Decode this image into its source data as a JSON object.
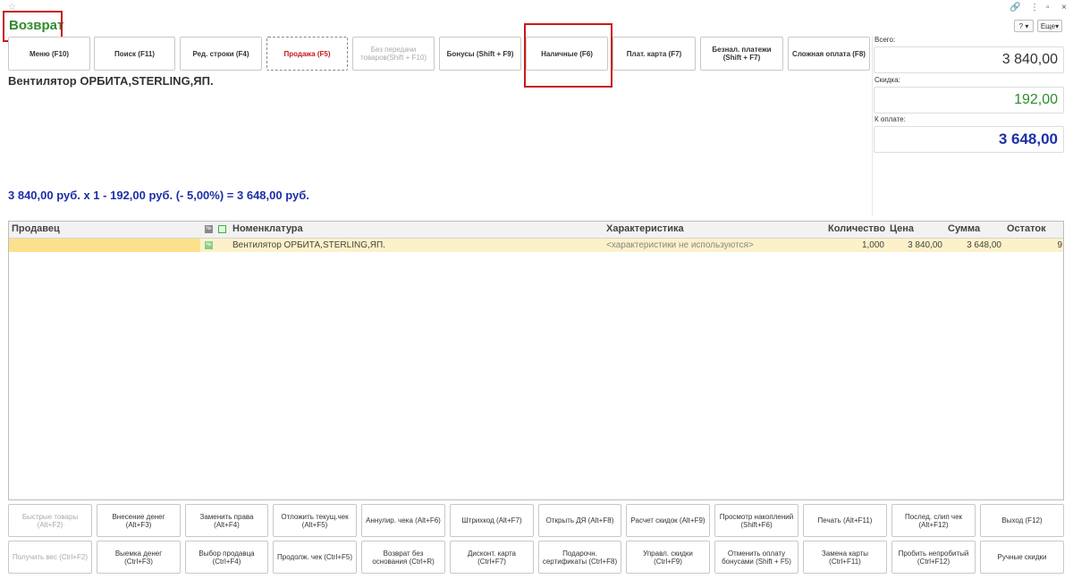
{
  "window": {
    "title": "Возврат",
    "more_label": "Еще"
  },
  "toolbar": [
    {
      "id": "menu",
      "label": "Меню (F10)"
    },
    {
      "id": "search",
      "label": "Поиск (F11)"
    },
    {
      "id": "edit-row",
      "label": "Ред. строки (F4)"
    },
    {
      "id": "sale",
      "label": "Продажа (F5)"
    },
    {
      "id": "no-transfer",
      "label": "Без передачи товаров(Shift + F10)"
    },
    {
      "id": "bonuses",
      "label": "Бонусы (Shift + F9)"
    },
    {
      "id": "cash",
      "label": "Наличные (F6)"
    },
    {
      "id": "card",
      "label": "Плат. карта (F7)"
    },
    {
      "id": "cashless",
      "label": "Безнал. платежи (Shift + F7)"
    },
    {
      "id": "complex",
      "label": "Сложная оплата (F8)"
    }
  ],
  "product": {
    "name": "Вентилятор ОРБИТА,STERLING,ЯП.",
    "calc": "3 840,00 руб. x 1  - 192,00 руб. (- 5,00%) = 3 648,00 руб."
  },
  "summary": {
    "total_label": "Всего:",
    "total_value": "3 840,00",
    "discount_label": "Скидка:",
    "discount_value": "192,00",
    "pay_label": "К оплате:",
    "pay_value": "3 648,00",
    "colors": {
      "discount": "#2e8b2e",
      "pay": "#1c2fa8"
    }
  },
  "table": {
    "columns": {
      "seller": "Продавец",
      "num": "№",
      "nomenclature": "Номенклатура",
      "characteristic": "Характеристика",
      "quantity": "Количество",
      "price": "Цена",
      "sum": "Сумма",
      "rest": "Остаток"
    },
    "rows": [
      {
        "seller": "",
        "nomenclature": "Вентилятор ОРБИТА,STERLING,ЯП.",
        "characteristic": "<характеристики не используются>",
        "quantity": "1,000",
        "price": "3 840,00",
        "sum": "3 648,00",
        "rest": "9"
      }
    ]
  },
  "bottom_row1": [
    {
      "label": "Быстрые товары (Alt+F2)",
      "dim": true
    },
    {
      "label": "Внесение денег (Alt+F3)"
    },
    {
      "label": "Заменить права (Alt+F4)"
    },
    {
      "label": "Отложить текущ.чек (Alt+F5)"
    },
    {
      "label": "Аннулир. чека (Alt+F6)"
    },
    {
      "label": "Штрихкод (Alt+F7)"
    },
    {
      "label": "Открыть ДЯ (Alt+F8)"
    },
    {
      "label": "Расчет скидок (Alt+F9)"
    },
    {
      "label": "Просмотр накоплений (Shift+F6)"
    },
    {
      "label": "Печать (Alt+F11)"
    },
    {
      "label": "Послед. слип чек (Alt+F12)"
    },
    {
      "label": "Выход (F12)"
    }
  ],
  "bottom_row2": [
    {
      "label": "Получить вес (Ctrl+F2)",
      "dim": true
    },
    {
      "label": "Выемка денег (Ctrl+F3)"
    },
    {
      "label": "Выбор продавца (Ctrl+F4)"
    },
    {
      "label": "Продолж. чек (Ctrl+F5)"
    },
    {
      "label": "Возврат без основания (Ctrl+R)"
    },
    {
      "label": "Дисконт. карта (Ctrl+F7)"
    },
    {
      "label": "Подарочн. сертификаты (Ctrl+F8)"
    },
    {
      "label": "Управл. скидки (Ctrl+F9)"
    },
    {
      "label": "Отменить оплату бонусами (Shift + F5)"
    },
    {
      "label": "Замена карты (Ctrl+F11)"
    },
    {
      "label": "Пробить непробитый (Ctrl+F12)"
    },
    {
      "label": "Ручные скидки"
    }
  ]
}
